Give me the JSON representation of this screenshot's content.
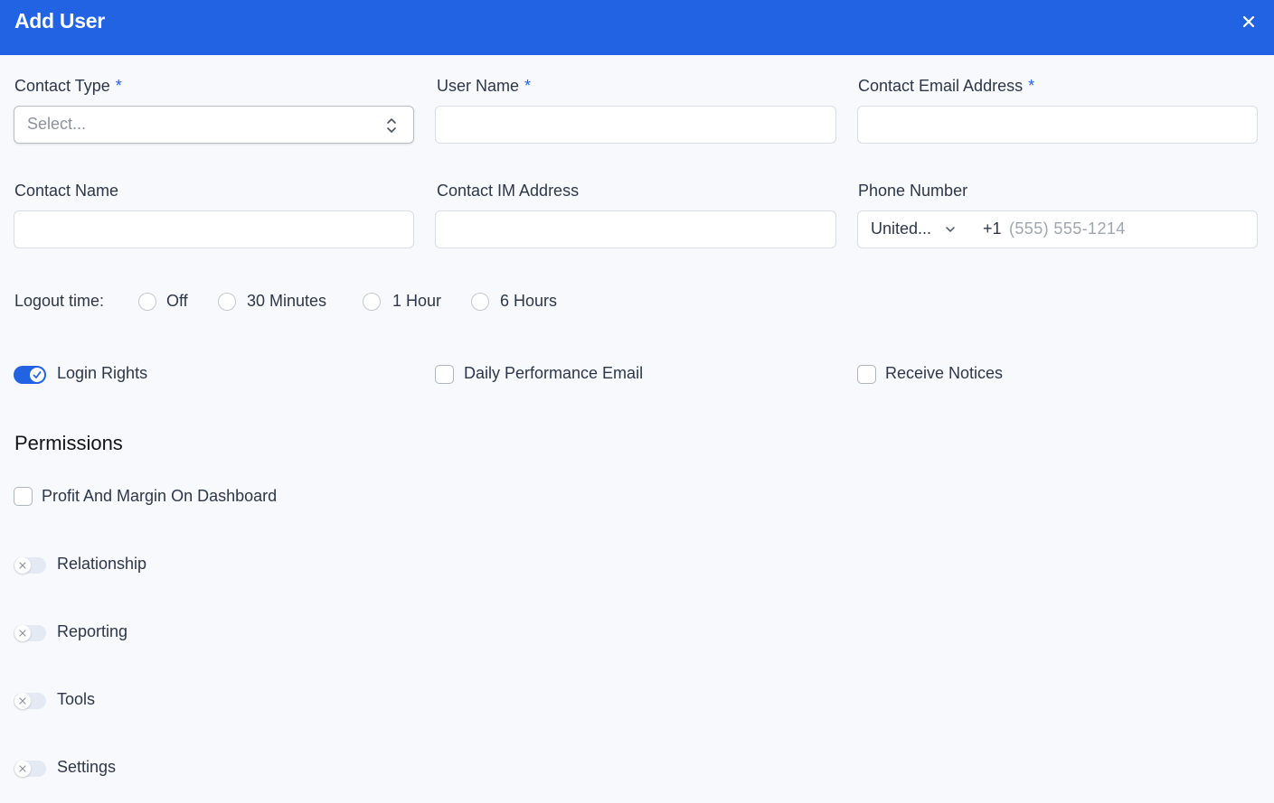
{
  "header": {
    "title": "Add User",
    "close_icon": "close-icon",
    "background": "#2263e3"
  },
  "form": {
    "contact_type": {
      "label": "Contact Type",
      "required": "*",
      "placeholder": "Select...",
      "icon": "select-arrows-icon"
    },
    "user_name": {
      "label": "User Name",
      "required": "*",
      "value": ""
    },
    "contact_email": {
      "label": "Contact Email Address",
      "required": "*",
      "value": ""
    },
    "contact_name": {
      "label": "Contact Name",
      "value": ""
    },
    "contact_im": {
      "label": "Contact IM Address",
      "value": ""
    },
    "phone": {
      "label": "Phone Number",
      "country": "United...",
      "country_icon": "chevron-down-icon",
      "dial_code": "+1",
      "placeholder": "(555) 555-1214"
    },
    "logout_time": {
      "label": "Logout time:",
      "options": [
        "Off",
        "30 Minutes",
        "1 Hour",
        "6 Hours"
      ],
      "selected": null
    },
    "login_rights": {
      "label": "Login Rights",
      "checked": true
    },
    "daily_performance_email": {
      "label": "Daily Performance Email",
      "checked": false
    },
    "receive_notices": {
      "label": "Receive Notices",
      "checked": false
    }
  },
  "permissions": {
    "title": "Permissions",
    "profit_margin": {
      "label": "Profit And Margin On Dashboard",
      "checked": false
    },
    "toggles": [
      {
        "label": "Relationship",
        "enabled": false
      },
      {
        "label": "Reporting",
        "enabled": false
      },
      {
        "label": "Tools",
        "enabled": false
      },
      {
        "label": "Settings",
        "enabled": false
      }
    ]
  },
  "colors": {
    "accent": "#2263e3",
    "background": "#f7f9fd",
    "text": "#2d3748"
  }
}
